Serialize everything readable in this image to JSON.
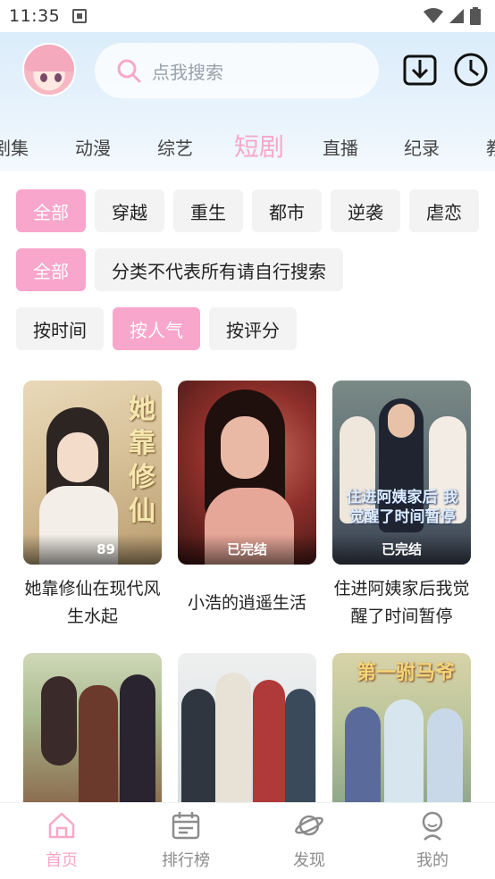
{
  "status_bar": {
    "time": "11:35"
  },
  "search": {
    "placeholder": "点我搜索"
  },
  "category_tabs": [
    "剧集",
    "动漫",
    "综艺",
    "短剧",
    "直播",
    "纪录",
    "教"
  ],
  "active_tab": "短剧",
  "genre_filters": [
    "全部",
    "穿越",
    "重生",
    "都市",
    "逆袭",
    "虐恋"
  ],
  "tag_filters": [
    "全部",
    "分类不代表所有请自行搜索"
  ],
  "sort_options": [
    "按时间",
    "按人气",
    "按评分"
  ],
  "videos": [
    {
      "title": "她靠修仙在现代风生水起",
      "badge": "89",
      "poster_text": "她靠修仙"
    },
    {
      "title": "小浩的逍遥生活",
      "badge": "已完结",
      "poster_text": ""
    },
    {
      "title": "住进阿姨家后我觉醒了时间暂停",
      "badge": "已完结",
      "poster_text": "住进阿姨家后 我觉醒了时间暂停"
    },
    {
      "title": "",
      "badge": "",
      "poster_text": ""
    },
    {
      "title": "",
      "badge": "",
      "poster_text": ""
    },
    {
      "title": "",
      "badge": "",
      "poster_text": "第一驸马爷"
    }
  ],
  "bottom_nav": [
    {
      "label": "首页",
      "icon": "home-icon"
    },
    {
      "label": "排行榜",
      "icon": "calendar-icon"
    },
    {
      "label": "发现",
      "icon": "planet-icon"
    },
    {
      "label": "我的",
      "icon": "user-icon"
    }
  ],
  "colors": {
    "accent": "#f9a6cc",
    "header_bg": "#dbecfa"
  }
}
